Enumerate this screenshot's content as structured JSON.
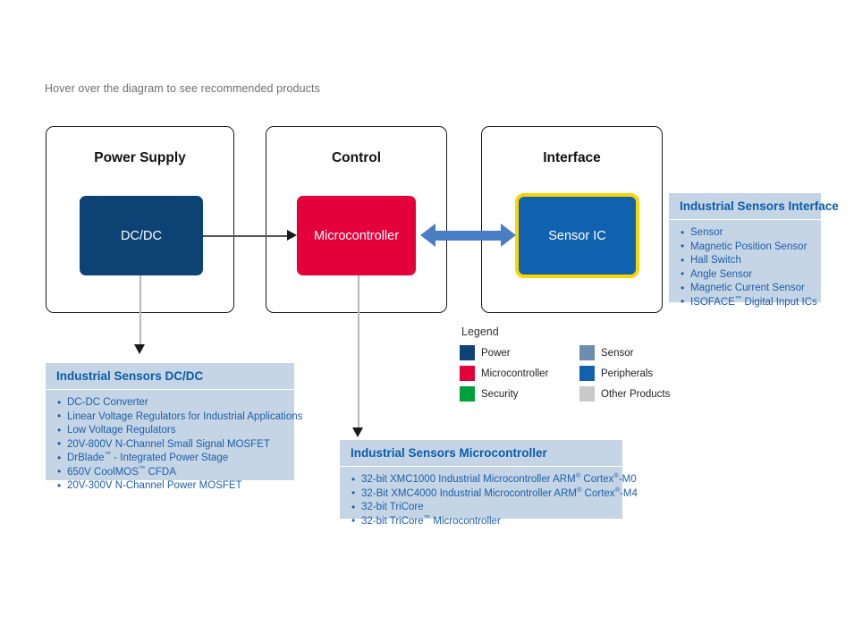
{
  "hint": "Hover over the diagram to see recommended products",
  "stages": [
    {
      "title": "Power Supply",
      "block": {
        "label": "DC/DC",
        "color": "#0d4275",
        "highlighted": false
      }
    },
    {
      "title": "Control",
      "block": {
        "label": "Microcontroller",
        "color": "#e4003a",
        "highlighted": false
      }
    },
    {
      "title": "Interface",
      "block": {
        "label": "Sensor IC",
        "color": "#1162ae",
        "highlighted": true,
        "highlight_color": "#ffd500"
      }
    }
  ],
  "panels": {
    "dcdc": {
      "title": "Industrial Sensors DC/DC",
      "items": [
        "DC-DC Converter",
        "Linear Voltage Regulators for Industrial Applications",
        "Low Voltage Regulators",
        "20V-800V N-Channel Small Signal MOSFET",
        "DrBlade™ - Integrated Power Stage",
        "650V CoolMOS™ CFDA",
        "20V-300V N-Channel Power MOSFET"
      ]
    },
    "microcontroller": {
      "title": "Industrial Sensors Microcontroller",
      "items": [
        "32-bit XMC1000 Industrial Microcontroller ARM® Cortex®-M0",
        "32-Bit XMC4000 Industrial Microcontroller ARM® Cortex®-M4",
        "32-bit TriCore",
        "32-bit TriCore™ Microcontroller"
      ]
    },
    "interface": {
      "title": "Industrial Sensors Interface",
      "items": [
        "Sensor",
        "Magnetic Position Sensor",
        "Hall Switch",
        "Angle Sensor",
        "Magnetic Current Sensor",
        "ISOFACE™ Digital Input ICs"
      ]
    }
  },
  "legend": {
    "title": "Legend",
    "items": [
      {
        "label": "Power",
        "color": "#0d4275"
      },
      {
        "label": "Sensor",
        "color": "#6e8cb0"
      },
      {
        "label": "Microcontroller",
        "color": "#e4003a"
      },
      {
        "label": "Peripherals",
        "color": "#1162ae"
      },
      {
        "label": "Security",
        "color": "#00a13a"
      },
      {
        "label": "Other Products",
        "color": "#c9c9c9"
      }
    ]
  }
}
